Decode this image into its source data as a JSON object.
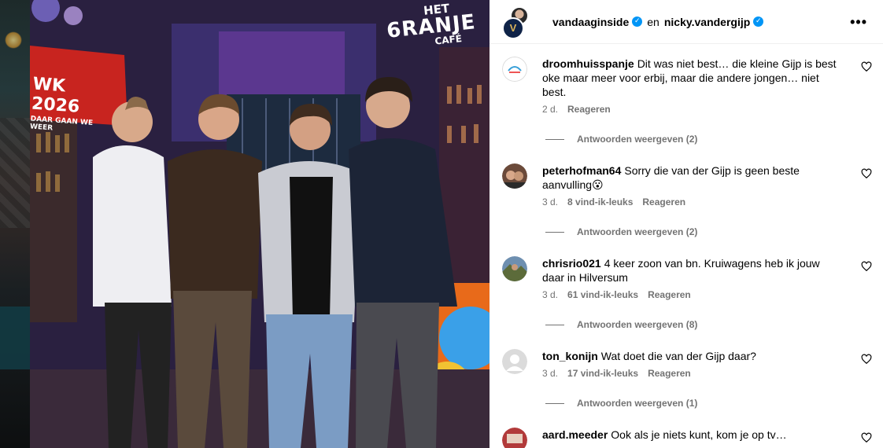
{
  "photo": {
    "logo": {
      "line1": "HET",
      "line2": "6RANJE",
      "line3": "CAFÉ"
    },
    "banner": {
      "line1": "WK 2026",
      "line2": "DAAR GAAN WE WEER"
    }
  },
  "header": {
    "user1": "vandaaginside",
    "conjunction": "en",
    "user2": "nicky.vandergijp",
    "more_icon": "more-horizontal-icon",
    "avatar_letter": "V"
  },
  "comments": [
    {
      "username": "droomhuisspanje",
      "text": "Dit was niet best… die kleine Gijp is best oke maar meer voor erbij, maar die andere jongen… niet best.",
      "time": "2 d.",
      "likes": "",
      "reply_label": "Reageren",
      "view_replies": "Antwoorden weergeven (2)"
    },
    {
      "username": "peterhofman64",
      "text": "Sorry die van der Gijp is geen beste aanvulling😮",
      "time": "3 d.",
      "likes": "8 vind-ik-leuks",
      "reply_label": "Reageren",
      "view_replies": "Antwoorden weergeven (2)"
    },
    {
      "username": "chrisrio021",
      "text": "4 keer zoon van bn. Kruiwagens heb ik jouw daar in Hilversum",
      "time": "3 d.",
      "likes": "61 vind-ik-leuks",
      "reply_label": "Reageren",
      "view_replies": "Antwoorden weergeven (8)"
    },
    {
      "username": "ton_konijn",
      "text": "Wat doet die van der Gijp daar?",
      "time": "3 d.",
      "likes": "17 vind-ik-leuks",
      "reply_label": "Reageren",
      "view_replies": "Antwoorden weergeven (1)"
    },
    {
      "username": "aard.meeder",
      "text": "Ook als je niets kunt, kom je op tv…",
      "time": "",
      "likes": "",
      "reply_label": "",
      "view_replies": ""
    }
  ],
  "colors": {
    "verified": "#0095f6",
    "meta": "#737373"
  }
}
